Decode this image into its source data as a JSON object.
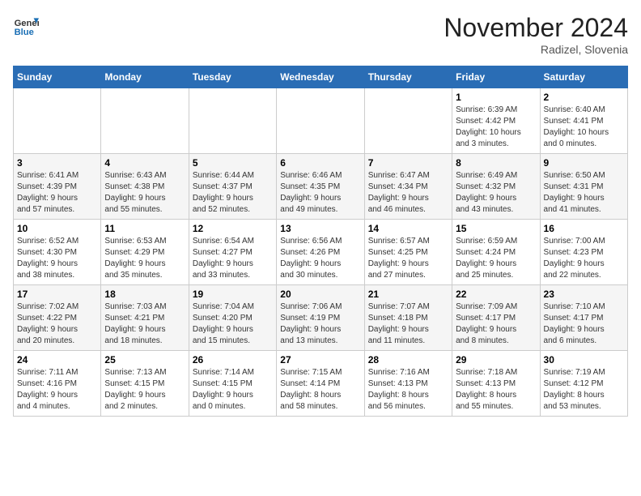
{
  "header": {
    "logo_line1": "General",
    "logo_line2": "Blue",
    "month_title": "November 2024",
    "location": "Radizel, Slovenia"
  },
  "days_of_week": [
    "Sunday",
    "Monday",
    "Tuesday",
    "Wednesday",
    "Thursday",
    "Friday",
    "Saturday"
  ],
  "weeks": [
    [
      {
        "day": "",
        "info": ""
      },
      {
        "day": "",
        "info": ""
      },
      {
        "day": "",
        "info": ""
      },
      {
        "day": "",
        "info": ""
      },
      {
        "day": "",
        "info": ""
      },
      {
        "day": "1",
        "info": "Sunrise: 6:39 AM\nSunset: 4:42 PM\nDaylight: 10 hours\nand 3 minutes."
      },
      {
        "day": "2",
        "info": "Sunrise: 6:40 AM\nSunset: 4:41 PM\nDaylight: 10 hours\nand 0 minutes."
      }
    ],
    [
      {
        "day": "3",
        "info": "Sunrise: 6:41 AM\nSunset: 4:39 PM\nDaylight: 9 hours\nand 57 minutes."
      },
      {
        "day": "4",
        "info": "Sunrise: 6:43 AM\nSunset: 4:38 PM\nDaylight: 9 hours\nand 55 minutes."
      },
      {
        "day": "5",
        "info": "Sunrise: 6:44 AM\nSunset: 4:37 PM\nDaylight: 9 hours\nand 52 minutes."
      },
      {
        "day": "6",
        "info": "Sunrise: 6:46 AM\nSunset: 4:35 PM\nDaylight: 9 hours\nand 49 minutes."
      },
      {
        "day": "7",
        "info": "Sunrise: 6:47 AM\nSunset: 4:34 PM\nDaylight: 9 hours\nand 46 minutes."
      },
      {
        "day": "8",
        "info": "Sunrise: 6:49 AM\nSunset: 4:32 PM\nDaylight: 9 hours\nand 43 minutes."
      },
      {
        "day": "9",
        "info": "Sunrise: 6:50 AM\nSunset: 4:31 PM\nDaylight: 9 hours\nand 41 minutes."
      }
    ],
    [
      {
        "day": "10",
        "info": "Sunrise: 6:52 AM\nSunset: 4:30 PM\nDaylight: 9 hours\nand 38 minutes."
      },
      {
        "day": "11",
        "info": "Sunrise: 6:53 AM\nSunset: 4:29 PM\nDaylight: 9 hours\nand 35 minutes."
      },
      {
        "day": "12",
        "info": "Sunrise: 6:54 AM\nSunset: 4:27 PM\nDaylight: 9 hours\nand 33 minutes."
      },
      {
        "day": "13",
        "info": "Sunrise: 6:56 AM\nSunset: 4:26 PM\nDaylight: 9 hours\nand 30 minutes."
      },
      {
        "day": "14",
        "info": "Sunrise: 6:57 AM\nSunset: 4:25 PM\nDaylight: 9 hours\nand 27 minutes."
      },
      {
        "day": "15",
        "info": "Sunrise: 6:59 AM\nSunset: 4:24 PM\nDaylight: 9 hours\nand 25 minutes."
      },
      {
        "day": "16",
        "info": "Sunrise: 7:00 AM\nSunset: 4:23 PM\nDaylight: 9 hours\nand 22 minutes."
      }
    ],
    [
      {
        "day": "17",
        "info": "Sunrise: 7:02 AM\nSunset: 4:22 PM\nDaylight: 9 hours\nand 20 minutes."
      },
      {
        "day": "18",
        "info": "Sunrise: 7:03 AM\nSunset: 4:21 PM\nDaylight: 9 hours\nand 18 minutes."
      },
      {
        "day": "19",
        "info": "Sunrise: 7:04 AM\nSunset: 4:20 PM\nDaylight: 9 hours\nand 15 minutes."
      },
      {
        "day": "20",
        "info": "Sunrise: 7:06 AM\nSunset: 4:19 PM\nDaylight: 9 hours\nand 13 minutes."
      },
      {
        "day": "21",
        "info": "Sunrise: 7:07 AM\nSunset: 4:18 PM\nDaylight: 9 hours\nand 11 minutes."
      },
      {
        "day": "22",
        "info": "Sunrise: 7:09 AM\nSunset: 4:17 PM\nDaylight: 9 hours\nand 8 minutes."
      },
      {
        "day": "23",
        "info": "Sunrise: 7:10 AM\nSunset: 4:17 PM\nDaylight: 9 hours\nand 6 minutes."
      }
    ],
    [
      {
        "day": "24",
        "info": "Sunrise: 7:11 AM\nSunset: 4:16 PM\nDaylight: 9 hours\nand 4 minutes."
      },
      {
        "day": "25",
        "info": "Sunrise: 7:13 AM\nSunset: 4:15 PM\nDaylight: 9 hours\nand 2 minutes."
      },
      {
        "day": "26",
        "info": "Sunrise: 7:14 AM\nSunset: 4:15 PM\nDaylight: 9 hours\nand 0 minutes."
      },
      {
        "day": "27",
        "info": "Sunrise: 7:15 AM\nSunset: 4:14 PM\nDaylight: 8 hours\nand 58 minutes."
      },
      {
        "day": "28",
        "info": "Sunrise: 7:16 AM\nSunset: 4:13 PM\nDaylight: 8 hours\nand 56 minutes."
      },
      {
        "day": "29",
        "info": "Sunrise: 7:18 AM\nSunset: 4:13 PM\nDaylight: 8 hours\nand 55 minutes."
      },
      {
        "day": "30",
        "info": "Sunrise: 7:19 AM\nSunset: 4:12 PM\nDaylight: 8 hours\nand 53 minutes."
      }
    ]
  ]
}
